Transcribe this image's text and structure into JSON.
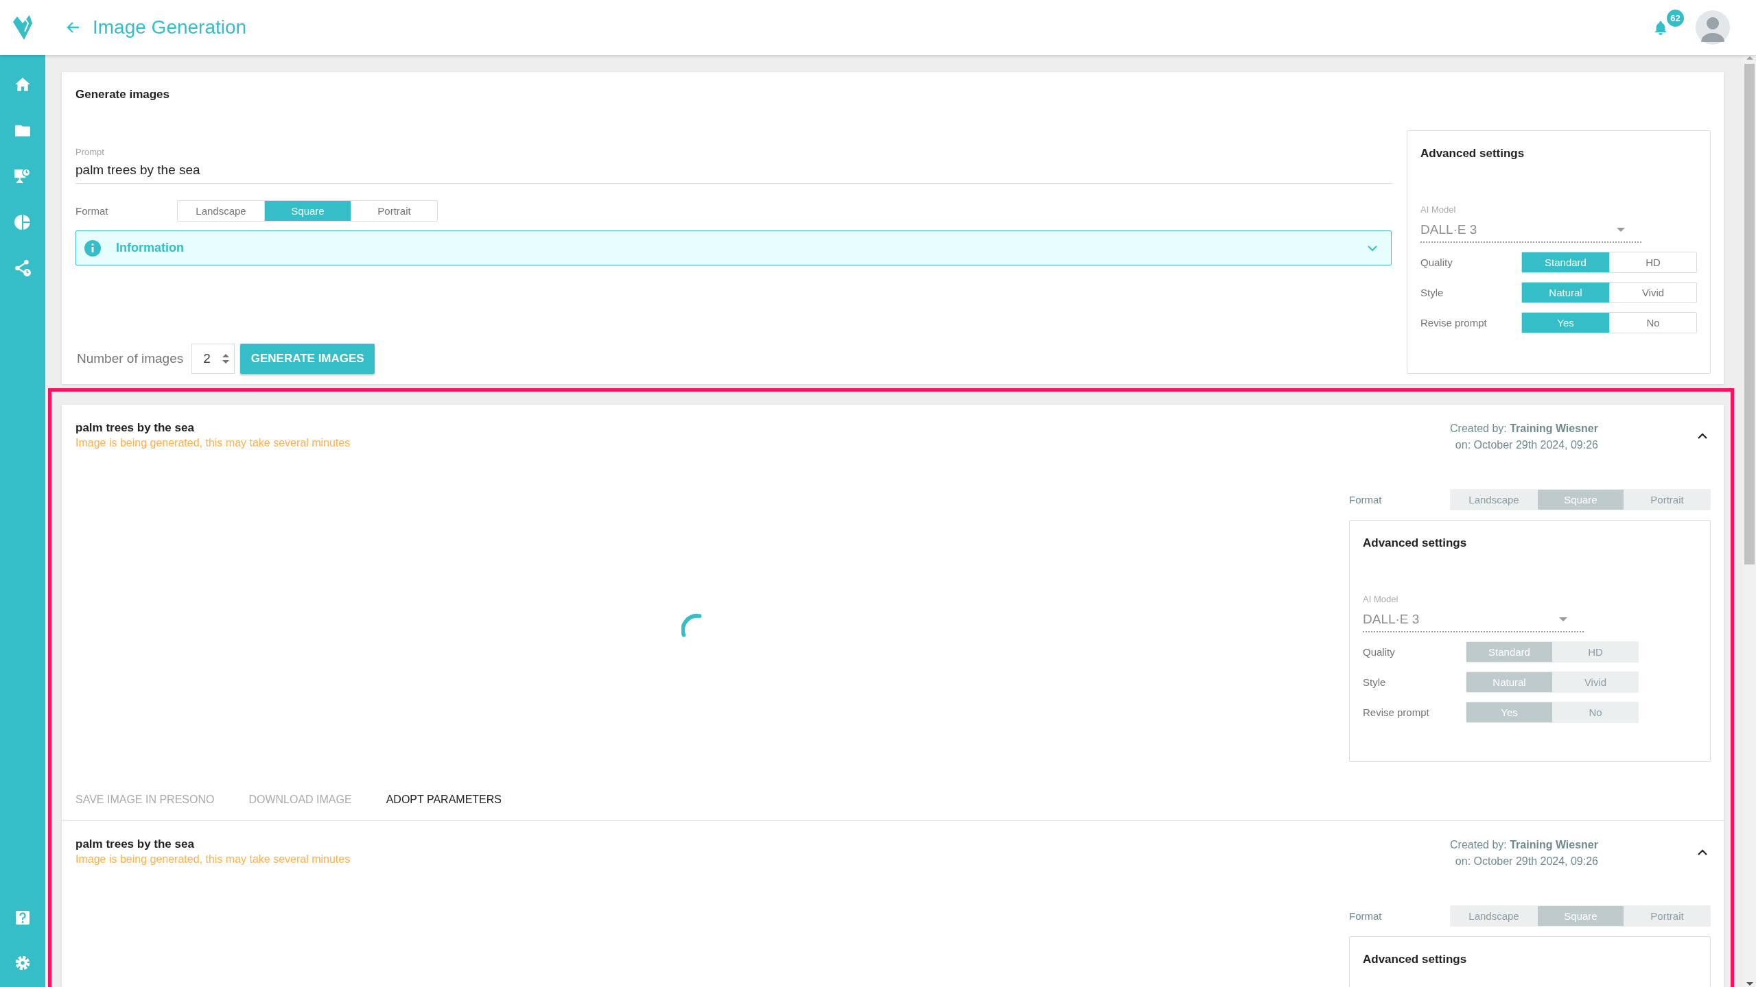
{
  "header": {
    "title": "Image Generation",
    "notifications": "62"
  },
  "generator": {
    "title": "Generate images",
    "prompt": {
      "label": "Prompt",
      "value": "palm trees by the sea"
    },
    "format": {
      "label": "Format",
      "options": [
        {
          "label": "Landscape",
          "selected": false
        },
        {
          "label": "Square",
          "selected": true
        },
        {
          "label": "Portrait",
          "selected": false
        }
      ]
    },
    "information": {
      "label": "Information",
      "expanded": false
    },
    "count": {
      "label": "Number of images",
      "value": "2"
    },
    "generate_button": "GENERATE IMAGES",
    "advanced_settings": {
      "title": "Advanced settings",
      "model": {
        "label": "AI Model",
        "value": "DALL·E 3"
      },
      "rows": [
        {
          "label": "Quality",
          "options": [
            {
              "label": "Standard",
              "selected": true
            },
            {
              "label": "HD",
              "selected": false
            }
          ]
        },
        {
          "label": "Style",
          "options": [
            {
              "label": "Natural",
              "selected": true
            },
            {
              "label": "Vivid",
              "selected": false
            }
          ]
        },
        {
          "label": "Revise prompt",
          "options": [
            {
              "label": "Yes",
              "selected": true
            },
            {
              "label": "No",
              "selected": false
            }
          ]
        }
      ]
    }
  },
  "results": [
    {
      "prompt": "palm trees by the sea",
      "status": "Image is being generated, this may take several minutes",
      "created_by": "Created by: **Training Wiesner**",
      "date": "on: October 29th 2024, 09:26",
      "expanded": true,
      "disabled": true,
      "loading": true,
      "format": {
        "label": "Format",
        "options": [
          {
            "label": "Landscape",
            "selected": false
          },
          {
            "label": "Square",
            "selected": true
          },
          {
            "label": "Portrait",
            "selected": false
          }
        ]
      },
      "advanced_settings": {
        "title": "Advanced settings",
        "model": {
          "label": "AI Model",
          "value": "DALL·E 3"
        },
        "rows": [
          {
            "label": "Quality",
            "options": [
              {
                "label": "Standard",
                "selected": true
              },
              {
                "label": "HD",
                "selected": false
              }
            ]
          },
          {
            "label": "Style",
            "options": [
              {
                "label": "Natural",
                "selected": true
              },
              {
                "label": "Vivid",
                "selected": false
              }
            ]
          },
          {
            "label": "Revise prompt",
            "options": [
              {
                "label": "Yes",
                "selected": true
              },
              {
                "label": "No",
                "selected": false
              }
            ]
          }
        ]
      },
      "actions": [
        {
          "label": "SAVE IMAGE IN PRESONO",
          "disabled": true
        },
        {
          "label": "DOWNLOAD IMAGE",
          "disabled": true
        },
        {
          "label": "ADOPT PARAMETERS",
          "disabled": false
        }
      ]
    },
    {
      "prompt": "palm trees by the sea",
      "status": "Image is being generated, this may take several minutes",
      "created_by": "Created by: **Training Wiesner**",
      "date": "on: October 29th 2024, 09:26",
      "expanded": true,
      "disabled": true,
      "format": {
        "label": "Format",
        "options": [
          {
            "label": "Landscape",
            "selected": false
          },
          {
            "label": "Square",
            "selected": true
          },
          {
            "label": "Portrait",
            "selected": false
          }
        ]
      },
      "advanced_settings": {
        "title": "Advanced settings"
      }
    }
  ]
}
